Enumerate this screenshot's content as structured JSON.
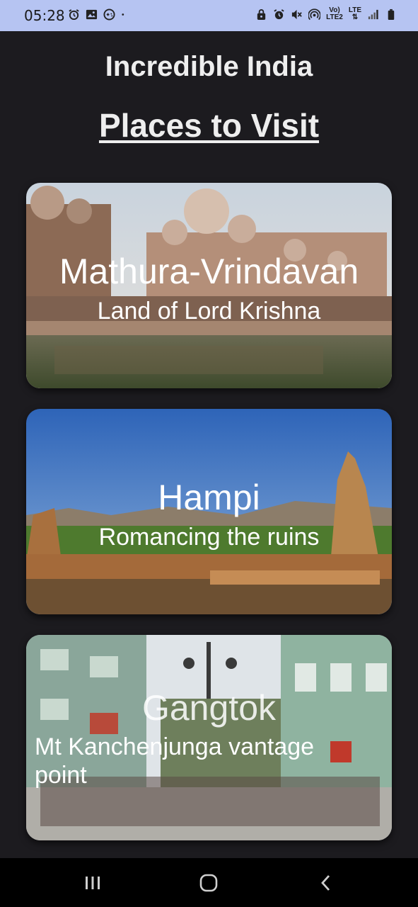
{
  "status_bar": {
    "time": "05:28",
    "left_icons": [
      "alarm-icon",
      "image-icon",
      "game-icon",
      "dot-icon"
    ],
    "right_icons": [
      "lock-icon",
      "alarm-icon",
      "mute-icon",
      "hotspot-icon",
      "volte-icon",
      "lte-icon",
      "signal-icon",
      "battery-icon"
    ],
    "volte_label_top": "Vo)",
    "volte_label_bottom": "LTE2",
    "lte_label": "LTE"
  },
  "app": {
    "title": "Incredible India",
    "section_title": "Places to Visit"
  },
  "places": [
    {
      "title": "Mathura-Vrindavan",
      "subtitle": "Land of Lord Krishna"
    },
    {
      "title": "Hampi",
      "subtitle": "Romancing the ruins"
    },
    {
      "title": "Gangtok",
      "subtitle": "Mt Kanchenjunga vantage point"
    }
  ],
  "nav_bar": {
    "buttons": [
      "recent-apps-icon",
      "home-icon",
      "back-icon"
    ]
  },
  "colors": {
    "background": "#1c1b1f",
    "status_bar": "#b6c4f2",
    "text": "#eeeeee",
    "nav_bar": "#000000"
  }
}
